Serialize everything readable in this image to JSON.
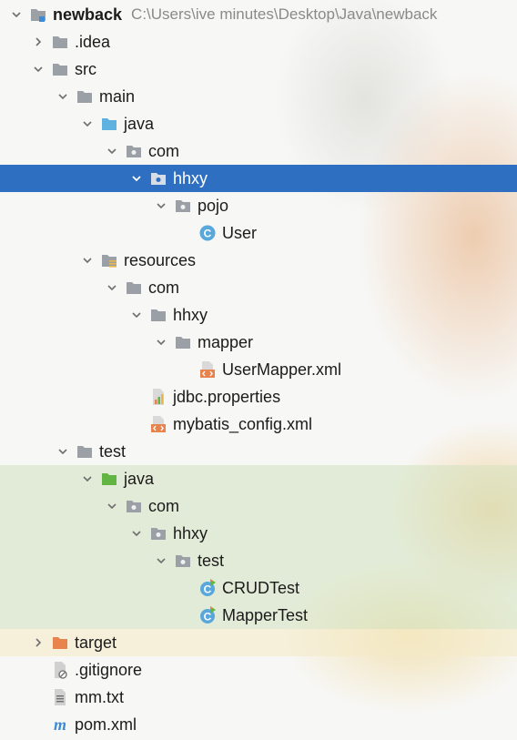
{
  "project": {
    "name": "newback",
    "path": "C:\\Users\\ive minutes\\Desktop\\Java\\newback"
  },
  "tree": {
    "idea": ".idea",
    "src": "src",
    "main": "main",
    "main_java": "java",
    "main_com": "com",
    "main_hhxy": "hhxy",
    "pojo": "pojo",
    "user": "User",
    "resources": "resources",
    "res_com": "com",
    "res_hhxy": "hhxy",
    "mapper": "mapper",
    "user_mapper_xml": "UserMapper.xml",
    "jdbc_properties": "jdbc.properties",
    "mybatis_config": "mybatis_config.xml",
    "test": "test",
    "test_java": "java",
    "test_com": "com",
    "test_hhxy": "hhxy",
    "test_pkg": "test",
    "crudtest": "CRUDTest",
    "mappertest": "MapperTest",
    "target": "target",
    "gitignore": ".gitignore",
    "mm_txt": "mm.txt",
    "pom_xml": "pom.xml"
  },
  "colors": {
    "selection": "#2f6fc1",
    "folder": "#9aa0a6",
    "source_folder": "#5fb2e0",
    "test_folder": "#62b543",
    "excluded_folder": "#e8834e",
    "class_icon": "#59a8dc"
  }
}
